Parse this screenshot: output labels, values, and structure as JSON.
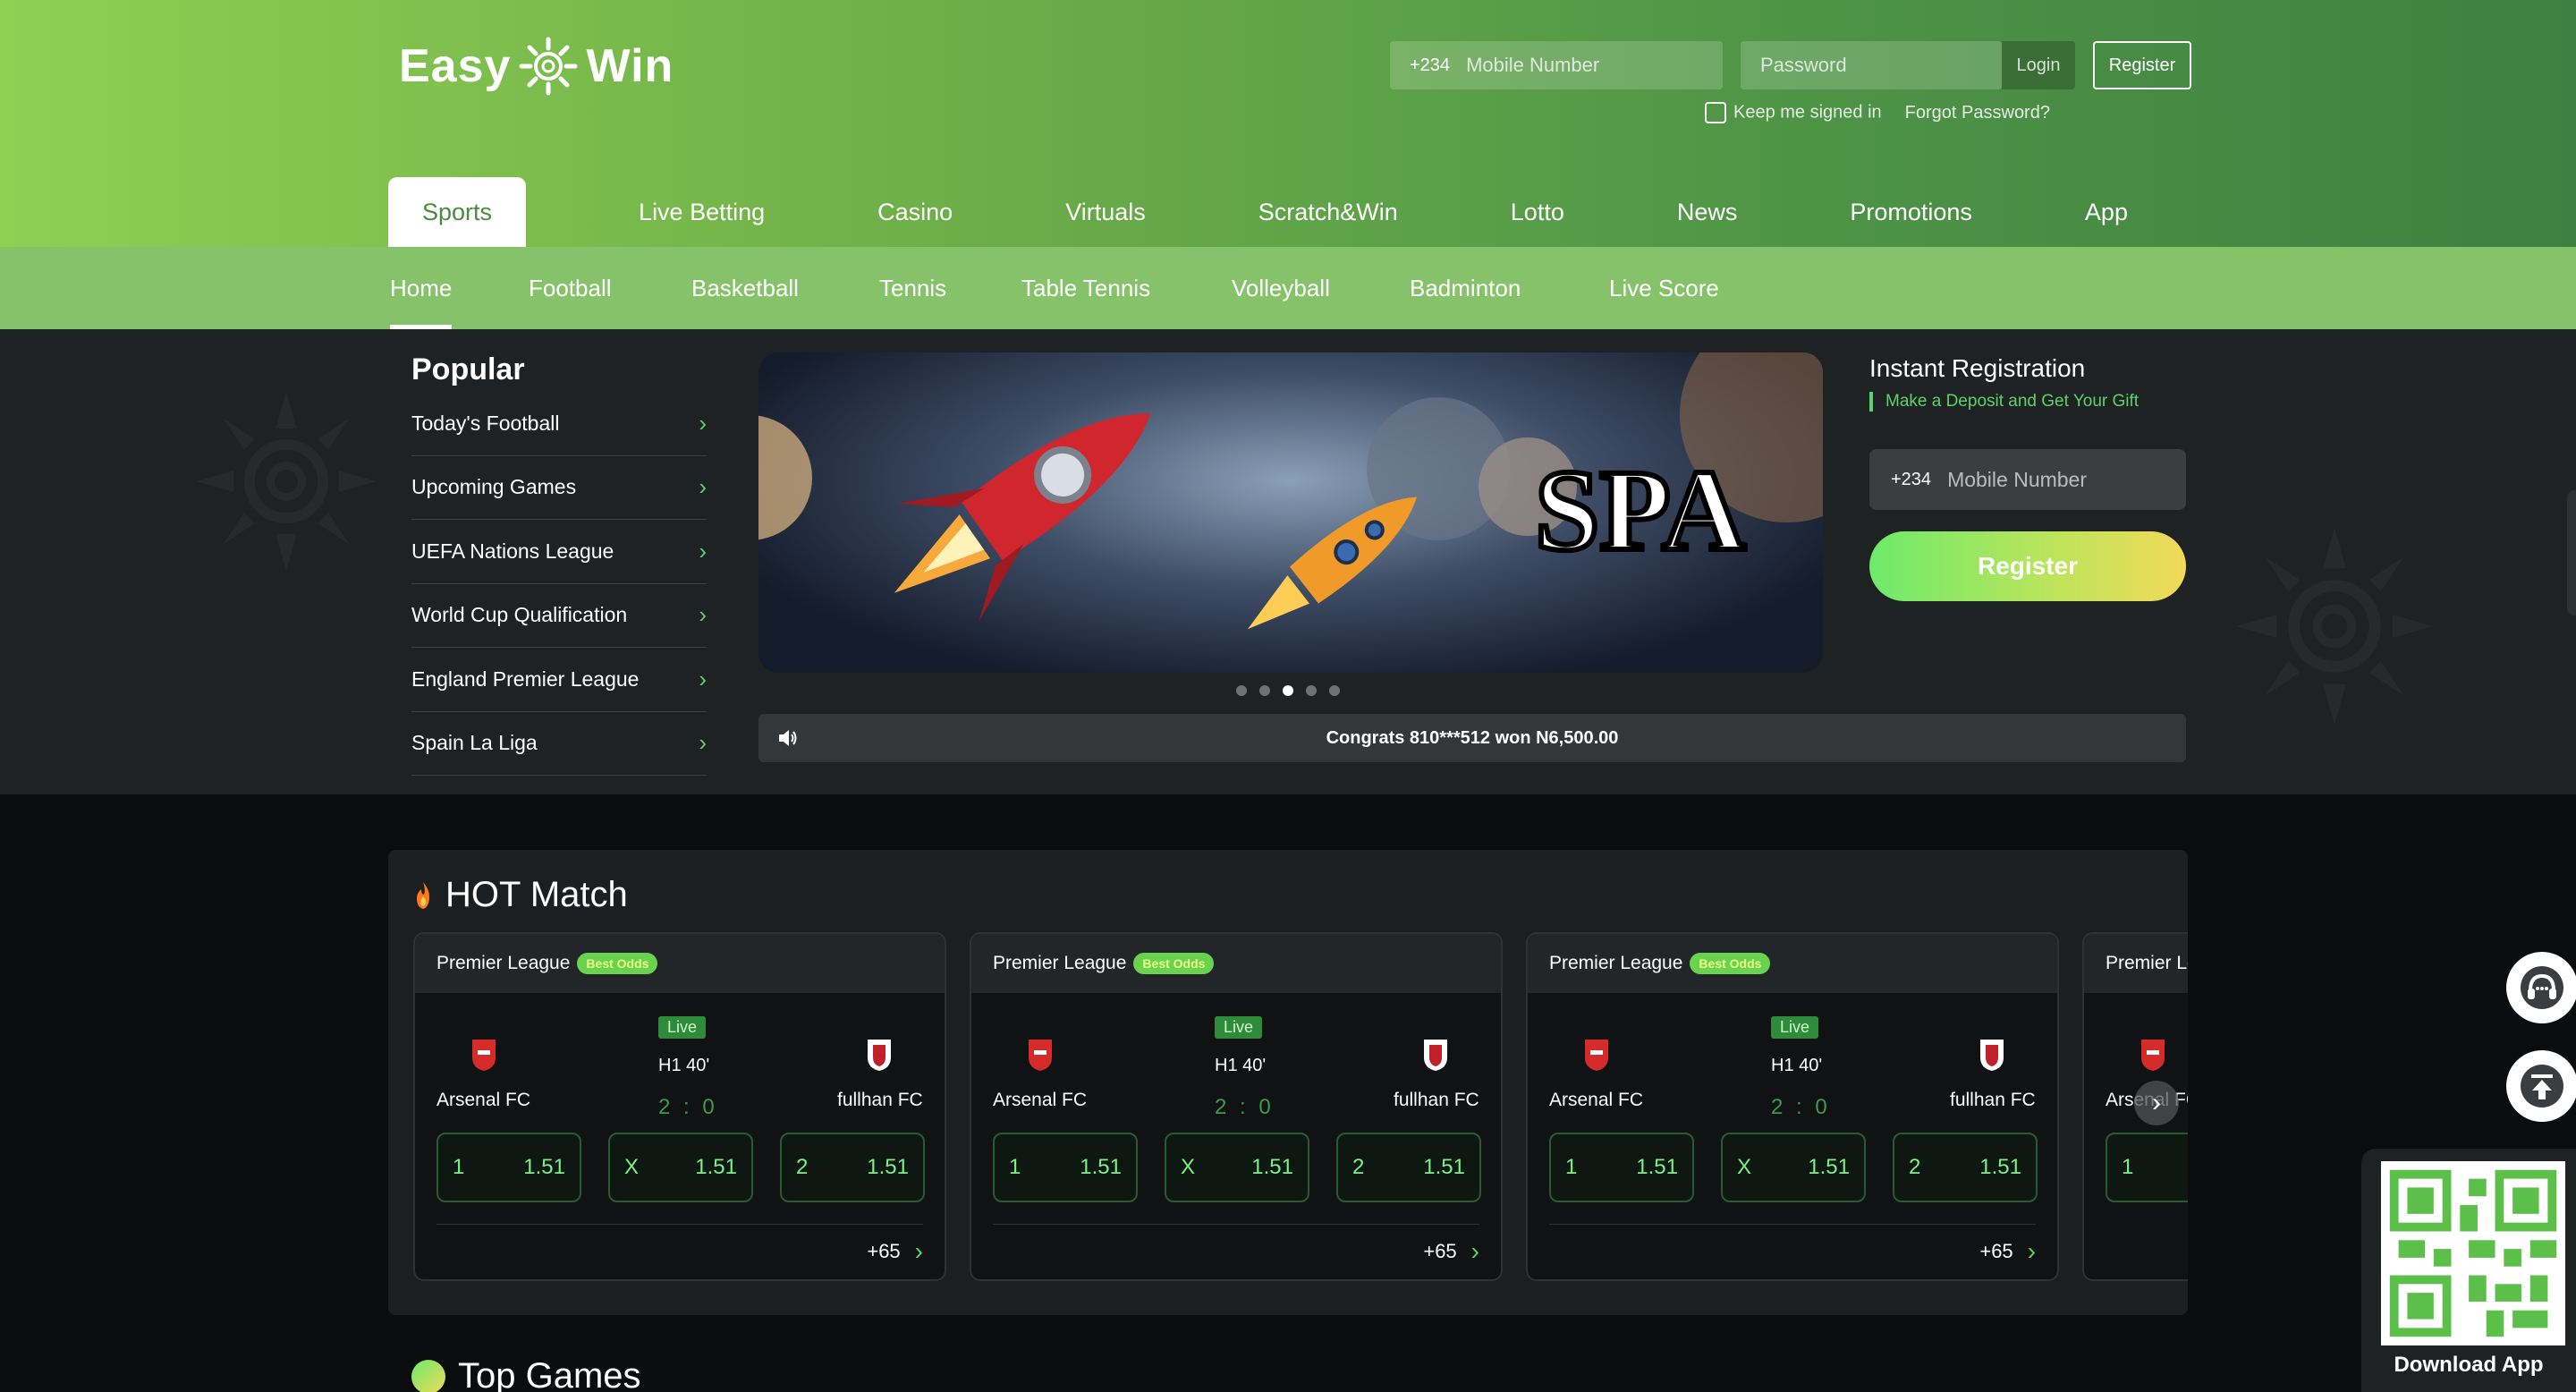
{
  "brand": {
    "logo_left": "Easy",
    "logo_right": "Win"
  },
  "auth": {
    "country_code": "+234",
    "mobile_placeholder": "Mobile Number",
    "password_placeholder": "Password",
    "login_label": "Login",
    "register_label": "Register",
    "keep_signed_in": "Keep me signed in",
    "forgot_password": "Forgot Password?"
  },
  "main_nav": [
    "Sports",
    "Live Betting",
    "Casino",
    "Virtuals",
    "Scratch&Win",
    "Lotto",
    "News",
    "Promotions",
    "App"
  ],
  "sub_nav": [
    "Home",
    "Football",
    "Basketball",
    "Tennis",
    "Table Tennis",
    "Volleyball",
    "Badminton",
    "Live Score"
  ],
  "popular": {
    "title": "Popular",
    "items": [
      "Today's Football",
      "Upcoming Games",
      "UEFA Nations League",
      "World Cup Qualification",
      "England Premier League",
      "Spain La Liga"
    ]
  },
  "banner": {
    "text": "SPA",
    "active_slide": 3,
    "total_slides": 5
  },
  "ticker": {
    "message": "Congrats 810***512 won N6,500.00"
  },
  "instant_registration": {
    "title": "Instant Registration",
    "subtitle": "Make a Deposit and Get Your Gift",
    "country_code": "+234",
    "mobile_placeholder": "Mobile Number",
    "register_label": "Register"
  },
  "hot_match": {
    "title": "HOT Match",
    "cards": [
      {
        "league": "Premier League",
        "badge": "Best Odds",
        "home": "Arsenal FC",
        "away": "fullhan FC",
        "status": "Live",
        "period": "H1 40'",
        "score": "2 : 0",
        "odds": [
          {
            "k": "1",
            "v": "1.51"
          },
          {
            "k": "X",
            "v": "1.51"
          },
          {
            "k": "2",
            "v": "1.51"
          }
        ],
        "more": "+65"
      },
      {
        "league": "Premier League",
        "badge": "Best Odds",
        "home": "Arsenal FC",
        "away": "fullhan FC",
        "status": "Live",
        "period": "H1 40'",
        "score": "2 : 0",
        "odds": [
          {
            "k": "1",
            "v": "1.51"
          },
          {
            "k": "X",
            "v": "1.51"
          },
          {
            "k": "2",
            "v": "1.51"
          }
        ],
        "more": "+65"
      },
      {
        "league": "Premier League",
        "badge": "Best Odds",
        "home": "Arsenal FC",
        "away": "fullhan FC",
        "status": "Live",
        "period": "H1 40'",
        "score": "2 : 0",
        "odds": [
          {
            "k": "1",
            "v": "1.51"
          },
          {
            "k": "X",
            "v": "1.51"
          },
          {
            "k": "2",
            "v": "1.51"
          }
        ],
        "more": "+65"
      },
      {
        "league": "Premier League",
        "badge": "",
        "home": "Arsenal FC",
        "away": "",
        "status": "",
        "period": "",
        "score": "",
        "odds": [
          {
            "k": "1",
            "v": ""
          }
        ],
        "more": ""
      }
    ]
  },
  "top_games": {
    "title": "Top Games"
  },
  "download": {
    "label": "Download App"
  },
  "colors": {
    "accent": "#5bd36a",
    "header_start": "#8fcf52",
    "header_end": "#3f7f41",
    "odds_text": "#7cf088"
  }
}
